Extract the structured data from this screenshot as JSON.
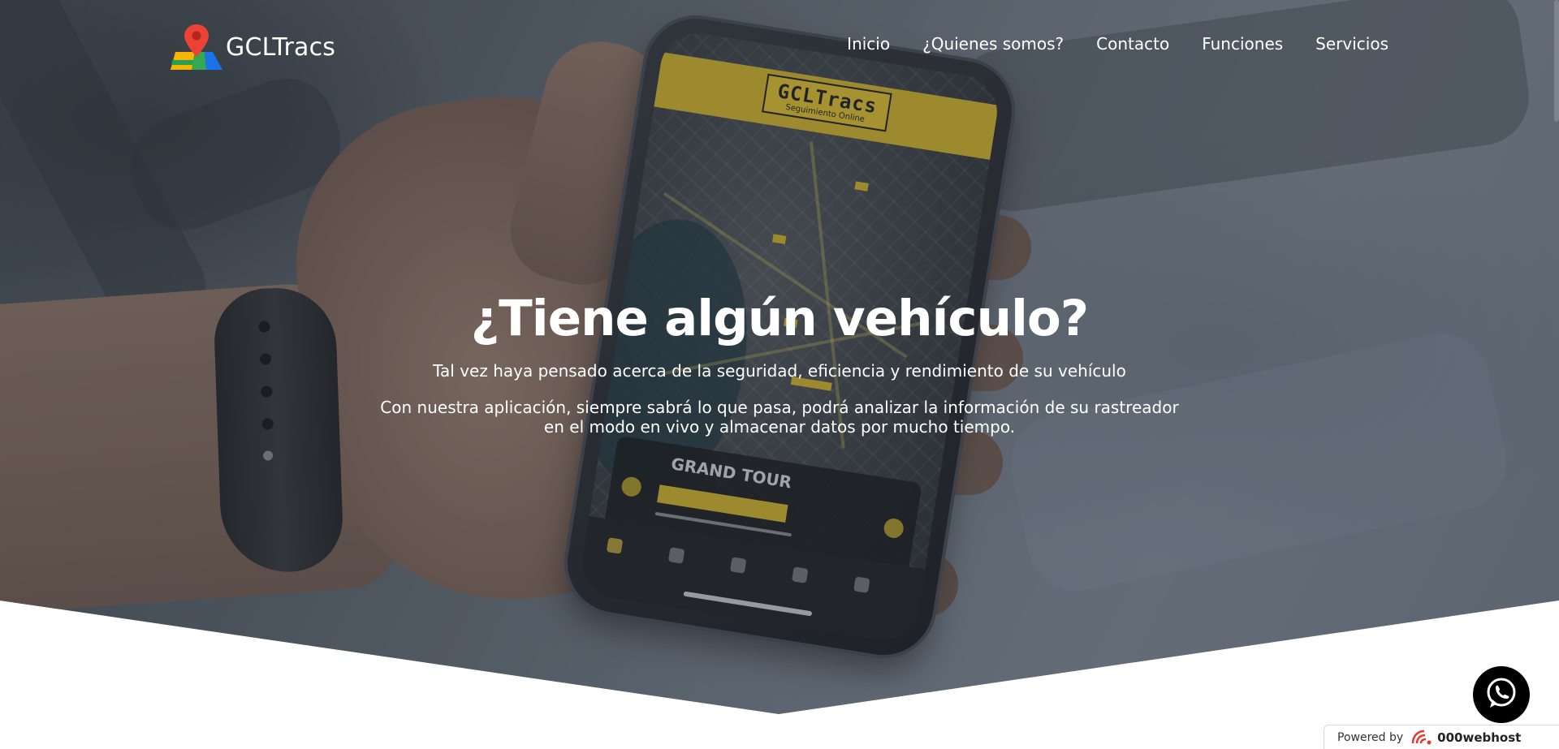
{
  "brand": {
    "name": "GCLTracs"
  },
  "nav": {
    "items": [
      {
        "label": "Inicio"
      },
      {
        "label": "¿Quienes somos?"
      },
      {
        "label": "Contacto"
      },
      {
        "label": "Funciones"
      },
      {
        "label": "Servicios"
      }
    ]
  },
  "hero": {
    "title": "¿Tiene algún vehículo?",
    "subtitle": "Tal vez haya pensado acerca de la seguridad, eficiencia y rendimiento de su vehículo",
    "description": "Con nuestra aplicación, siempre sabrá lo que pasa, podrá analizar la información de su rastreador en el modo en vivo y almacenar datos por mucho tiempo."
  },
  "phone_app": {
    "logo_title": "GCLTracs",
    "logo_subtitle": "Seguimiento Online",
    "card_title": "GRAND TOUR"
  },
  "widgets": {
    "whatsapp_icon": "whatsapp-icon",
    "powered_label": "Powered by",
    "powered_brand": "000webhost"
  },
  "colors": {
    "accent_yellow": "#d9b51c",
    "text": "#ffffff",
    "whatsapp_bg": "#000000"
  }
}
